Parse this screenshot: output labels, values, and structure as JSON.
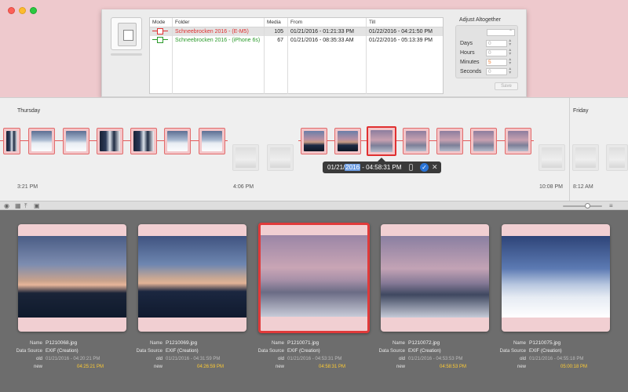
{
  "table": {
    "headers": [
      "Mode",
      "Folder",
      "Media",
      "From",
      "Till"
    ],
    "rows": [
      {
        "folder": "Schneebrocken 2016 - (E-M5)",
        "media": "105",
        "from": "01/21/2016 - 01:21:33 PM",
        "till": "01/22/2016 - 04:21:50 PM",
        "color": "#e03030"
      },
      {
        "folder": "Schneebrocken 2016 - (iPhone 6s)",
        "media": "67",
        "from": "01/21/2016 - 08:35:33 AM",
        "till": "01/22/2016 - 05:13:39 PM",
        "color": "#2a9a2a"
      }
    ]
  },
  "adjust": {
    "title": "Adjust Altogether",
    "labels": [
      "Days",
      "Hours",
      "Minutes",
      "Seconds"
    ],
    "values": [
      "0",
      "0",
      "5",
      "0"
    ],
    "save": "Save"
  },
  "timeline": {
    "day1": "Thursday",
    "day2": "Friday",
    "times": [
      "3:21 PM",
      "4:06 PM",
      "10:08 PM",
      "8:12 AM"
    ],
    "popover": {
      "prefix": "01/21/",
      "selected": "2016",
      "suffix": " - 04:58:31 PM"
    }
  },
  "gallery": {
    "labels": {
      "name": "Name",
      "source": "Data Source",
      "old": "old",
      "new": "new"
    },
    "items": [
      {
        "name": "P1210068.jpg",
        "source": "EXIF (Creation)",
        "old": "01/21/2016 - 04:20:21 PM",
        "new": "04:25:21 PM"
      },
      {
        "name": "P1210069.jpg",
        "source": "EXIF (Creation)",
        "old": "01/21/2016 - 04:31:59 PM",
        "new": "04:26:59 PM"
      },
      {
        "name": "P1210071.jpg",
        "source": "EXIF (Creation)",
        "old": "01/21/2016 - 04:53:31 PM",
        "new": "04:58:31 PM"
      },
      {
        "name": "P1210072.jpg",
        "source": "EXIF (Creation)",
        "old": "01/21/2016 - 04:53:53 PM",
        "new": "04:58:53 PM"
      },
      {
        "name": "P1210075.jpg",
        "source": "EXIF (Creation)",
        "old": "01/21/2016 - 04:55:18 PM",
        "new": "05:00:18 PM"
      }
    ]
  }
}
